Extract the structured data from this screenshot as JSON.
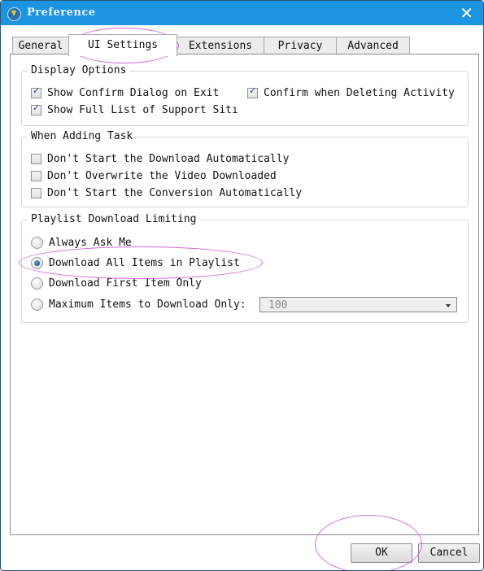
{
  "window": {
    "title": "Preference",
    "close_icon": "close-icon",
    "app_icon": "download-app-icon"
  },
  "tabs": [
    {
      "label": "General",
      "active": false
    },
    {
      "label": "UI Settings",
      "active": true
    },
    {
      "label": "Extensions",
      "active": false
    },
    {
      "label": "Privacy",
      "active": false
    },
    {
      "label": "Advanced",
      "active": false
    }
  ],
  "display_options": {
    "title": "Display Options",
    "items": [
      {
        "label": "Show Confirm Dialog on Exit",
        "checked": true
      },
      {
        "label": "Confirm when Deleting Activity",
        "checked": true
      },
      {
        "label": "Show Full List of Support Sitı",
        "checked": true
      }
    ]
  },
  "adding_task": {
    "title": "When Adding Task",
    "items": [
      {
        "label": "Don't Start the Download Automatically",
        "checked": false
      },
      {
        "label": "Don't Overwrite the Video Downloaded",
        "checked": false
      },
      {
        "label": "Don't Start the Conversion Automatically",
        "checked": false
      }
    ]
  },
  "playlist": {
    "title": "Playlist Download Limiting",
    "options": [
      {
        "label": "Always Ask Me",
        "selected": false
      },
      {
        "label": "Download All Items in Playlist",
        "selected": true
      },
      {
        "label": "Download First Item Only",
        "selected": false
      },
      {
        "label": "Maximum Items to Download Only:",
        "selected": false
      }
    ],
    "max_items_value": "100"
  },
  "buttons": {
    "ok": "OK",
    "cancel": "Cancel"
  },
  "annotation_color": "#d16bd8"
}
